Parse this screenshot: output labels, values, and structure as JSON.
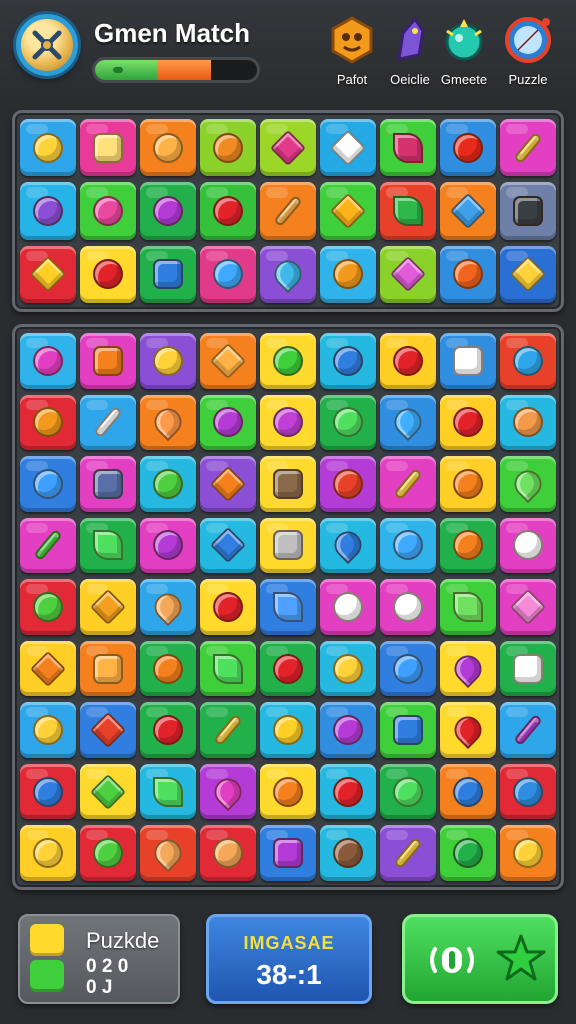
{
  "header": {
    "title": "Gmen Match",
    "progress_fraction": 0.7,
    "modes": [
      {
        "label": "Pafot",
        "icon": "orange-creature-icon",
        "color": "#f29a1c"
      },
      {
        "label": "Oeiclie",
        "icon": "purple-dragon-icon",
        "color": "#7b55d6"
      },
      {
        "label": "Gmeete",
        "icon": "teal-gem-icon",
        "color": "#25c9b0"
      },
      {
        "label": "Puzzle",
        "icon": "compass-icon",
        "color": "#2a7fd4"
      }
    ]
  },
  "top_board": {
    "rows": [
      [
        {
          "bg": "#2fa6ea",
          "fg": "#ffd33a",
          "shape": "round",
          "icon": "moon-icon"
        },
        {
          "bg": "#e93a9a",
          "fg": "#ffe07a",
          "shape": "square",
          "icon": "bell-icon"
        },
        {
          "bg": "#f4801e",
          "fg": "#ffb347",
          "shape": "round",
          "icon": "face-icon"
        },
        {
          "bg": "#8ad12a",
          "fg": "#f08a22",
          "shape": "round",
          "icon": "orange-icon"
        },
        {
          "bg": "#9bd628",
          "fg": "#e23a8a",
          "shape": "star",
          "icon": "flower-icon"
        },
        {
          "bg": "#25a9e5",
          "fg": "#ffffff",
          "shape": "star",
          "icon": "star-face-icon"
        },
        {
          "bg": "#3fcf3a",
          "fg": "#d6336e",
          "shape": "leaf",
          "icon": "berry-icon"
        },
        {
          "bg": "#2f8ee0",
          "fg": "#e82a1a",
          "shape": "round",
          "icon": "ball-icon"
        },
        {
          "bg": "#e33fc2",
          "fg": "#ffd23a",
          "shape": "bar",
          "icon": "pencil-icon"
        }
      ],
      [
        {
          "bg": "#25b3e8",
          "fg": "#8b4fd6",
          "shape": "round",
          "icon": "donut-icon"
        },
        {
          "bg": "#3fcf3a",
          "fg": "#e94aa0",
          "shape": "round",
          "icon": "lollipop-icon"
        },
        {
          "bg": "#21b04a",
          "fg": "#b43bd6",
          "shape": "round",
          "icon": "lollipop-icon"
        },
        {
          "bg": "#35c23a",
          "fg": "#e2232a",
          "shape": "round",
          "icon": "apple-icon"
        },
        {
          "bg": "#f4801e",
          "fg": "#ffb347",
          "shape": "bar",
          "icon": "carrot-icon"
        },
        {
          "bg": "#3fcf3a",
          "fg": "#ffb21a",
          "shape": "star",
          "icon": "star-icon"
        },
        {
          "bg": "#e8412a",
          "fg": "#2fb84a",
          "shape": "leaf",
          "icon": "leaf-icon"
        },
        {
          "bg": "#f4801e",
          "fg": "#3fa0ea",
          "shape": "star",
          "icon": "star-icon"
        },
        {
          "bg": "#6e7fa8",
          "fg": "#3a3f44",
          "shape": "square",
          "icon": "robot-icon"
        }
      ],
      [
        {
          "bg": "#e22a36",
          "fg": "#ffcf26",
          "shape": "star",
          "icon": "star-icon"
        },
        {
          "bg": "#ffd92b",
          "fg": "#e2232a",
          "shape": "round",
          "icon": "apple-icon"
        },
        {
          "bg": "#21b04a",
          "fg": "#2f7ee0",
          "shape": "square",
          "icon": "box-icon"
        },
        {
          "bg": "#e23a8a",
          "fg": "#3fa9ff",
          "shape": "round",
          "icon": "drop-icon"
        },
        {
          "bg": "#8b4fd6",
          "fg": "#3fb8ea",
          "shape": "drop",
          "icon": "wave-icon"
        },
        {
          "bg": "#2fb3ea",
          "fg": "#f29a1c",
          "shape": "round",
          "icon": "orange-icon"
        },
        {
          "bg": "#8ad12a",
          "fg": "#e05cd9",
          "shape": "star",
          "icon": "flower-icon"
        },
        {
          "bg": "#2f8ee0",
          "fg": "#f0641e",
          "shape": "round",
          "icon": "shell-icon"
        },
        {
          "bg": "#2a6fd4",
          "fg": "#ffd23a",
          "shape": "star",
          "icon": "sun-icon"
        }
      ]
    ]
  },
  "main_board": {
    "rows": [
      [
        {
          "bg": "#2fb3ea",
          "fg": "#e33fc2",
          "shape": "round",
          "icon": "ball-icon"
        },
        {
          "bg": "#e33fc2",
          "fg": "#f4801e",
          "shape": "square",
          "icon": "jar-icon"
        },
        {
          "bg": "#8b4fd6",
          "fg": "#ffd23a",
          "shape": "round",
          "icon": "lemon-icon"
        },
        {
          "bg": "#f4801e",
          "fg": "#ffb347",
          "shape": "star",
          "icon": "star-face-icon"
        },
        {
          "bg": "#ffd92b",
          "fg": "#3fcf3a",
          "shape": "round",
          "icon": "lollipop-icon"
        },
        {
          "bg": "#25b8e0",
          "fg": "#2f7ee0",
          "shape": "round",
          "icon": "apple-icon"
        },
        {
          "bg": "#ffcf26",
          "fg": "#e2232a",
          "shape": "round",
          "icon": "apple-icon"
        },
        {
          "bg": "#2f8ee0",
          "fg": "#ffffff",
          "shape": "square",
          "icon": "ghost-icon"
        },
        {
          "bg": "#e8412a",
          "fg": "#2fa6ea",
          "shape": "round",
          "icon": "apple-icon"
        }
      ],
      [
        {
          "bg": "#e22a36",
          "fg": "#f29a1c",
          "shape": "round",
          "icon": "apple-icon"
        },
        {
          "bg": "#2fa6ea",
          "fg": "#ffffff",
          "shape": "bar",
          "icon": "brush-icon"
        },
        {
          "bg": "#f4801e",
          "fg": "#ff9a4a",
          "shape": "drop",
          "icon": "heart-icon"
        },
        {
          "bg": "#3fcf3a",
          "fg": "#b43bd6",
          "shape": "round",
          "icon": "plum-icon"
        },
        {
          "bg": "#ffd92b",
          "fg": "#c23fd6",
          "shape": "round",
          "icon": "plum-icon"
        },
        {
          "bg": "#21b04a",
          "fg": "#4fe060",
          "shape": "round",
          "icon": "apple-icon"
        },
        {
          "bg": "#2f8ee0",
          "fg": "#3fb0ff",
          "shape": "drop",
          "icon": "drop-icon"
        },
        {
          "bg": "#ffcf26",
          "fg": "#e2232a",
          "shape": "round",
          "icon": "apple-icon"
        },
        {
          "bg": "#25b8e0",
          "fg": "#f29a4a",
          "shape": "round",
          "icon": "cat-face-icon"
        }
      ],
      [
        {
          "bg": "#2f7ee0",
          "fg": "#3fa0ff",
          "shape": "round",
          "icon": "bubble-icon"
        },
        {
          "bg": "#e33fc2",
          "fg": "#5a6fa8",
          "shape": "square",
          "icon": "tv-icon"
        },
        {
          "bg": "#25b8e0",
          "fg": "#4fd040",
          "shape": "round",
          "icon": "apple-icon"
        },
        {
          "bg": "#8b4fd6",
          "fg": "#f4801e",
          "shape": "star",
          "icon": "star-icon"
        },
        {
          "bg": "#ffd92b",
          "fg": "#8a6a4a",
          "shape": "square",
          "icon": "house-icon"
        },
        {
          "bg": "#b43bd6",
          "fg": "#e8412a",
          "shape": "round",
          "icon": "apple-icon"
        },
        {
          "bg": "#e33fc2",
          "fg": "#ffd23a",
          "shape": "bar",
          "icon": "cross-icon"
        },
        {
          "bg": "#ffcf26",
          "fg": "#f4801e",
          "shape": "round",
          "icon": "pumpkin-icon"
        },
        {
          "bg": "#3fcf3a",
          "fg": "#6fe060",
          "shape": "drop",
          "icon": "drop-icon"
        }
      ],
      [
        {
          "bg": "#e33fc2",
          "fg": "#3fcf3a",
          "shape": "bar",
          "icon": "cross-icon"
        },
        {
          "bg": "#21b04a",
          "fg": "#4fe060",
          "shape": "leaf",
          "icon": "leaf-icon"
        },
        {
          "bg": "#e33fc2",
          "fg": "#b43bd6",
          "shape": "round",
          "icon": "plum-icon"
        },
        {
          "bg": "#25b8e0",
          "fg": "#2f7ee0",
          "shape": "star",
          "icon": "gear-icon"
        },
        {
          "bg": "#ffd92b",
          "fg": "#c0c0c0",
          "shape": "square",
          "icon": "grid-icon"
        },
        {
          "bg": "#25b8e0",
          "fg": "#2f7ee0",
          "shape": "drop",
          "icon": "drop-icon"
        },
        {
          "bg": "#2fb3ea",
          "fg": "#3fa9ff",
          "shape": "round",
          "icon": "bubble-icon"
        },
        {
          "bg": "#21b04a",
          "fg": "#f4801e",
          "shape": "round",
          "icon": "orange-icon"
        },
        {
          "bg": "#e33fc2",
          "fg": "#ffffff",
          "shape": "round",
          "icon": "ghost-icon"
        }
      ],
      [
        {
          "bg": "#e22a36",
          "fg": "#4fd040",
          "shape": "round",
          "icon": "apple-icon"
        },
        {
          "bg": "#ffcf26",
          "fg": "#f4a01e",
          "shape": "star",
          "icon": "sun-icon"
        },
        {
          "bg": "#2fa6ea",
          "fg": "#f4a85a",
          "shape": "drop",
          "icon": "drop-icon"
        },
        {
          "bg": "#ffd92b",
          "fg": "#e2232a",
          "shape": "round",
          "icon": "apple-icon"
        },
        {
          "bg": "#2f7ee0",
          "fg": "#4fa0ff",
          "shape": "leaf",
          "icon": "leaf-icon"
        },
        {
          "bg": "#e33fc2",
          "fg": "#ffffff",
          "shape": "round",
          "icon": "cloud-icon"
        },
        {
          "bg": "#e33fc2",
          "fg": "#ffffff",
          "shape": "round",
          "icon": "ring-icon"
        },
        {
          "bg": "#3fcf3a",
          "fg": "#6fe060",
          "shape": "leaf",
          "icon": "leaf-icon"
        },
        {
          "bg": "#e33fc2",
          "fg": "#f58ad9",
          "shape": "star",
          "icon": "star-icon"
        }
      ],
      [
        {
          "bg": "#ffcf26",
          "fg": "#f4801e",
          "shape": "star",
          "icon": "flower-icon"
        },
        {
          "bg": "#f4801e",
          "fg": "#ffb347",
          "shape": "square",
          "icon": "house-icon"
        },
        {
          "bg": "#21b04a",
          "fg": "#f4801e",
          "shape": "round",
          "icon": "orange-icon"
        },
        {
          "bg": "#3fcf3a",
          "fg": "#4fe060",
          "shape": "leaf",
          "icon": "leaf-icon"
        },
        {
          "bg": "#21b04a",
          "fg": "#e2232a",
          "shape": "round",
          "icon": "apple-icon"
        },
        {
          "bg": "#25b8e0",
          "fg": "#ffd23a",
          "shape": "round",
          "icon": "lemon-icon"
        },
        {
          "bg": "#2f7ee0",
          "fg": "#3fa0ff",
          "shape": "round",
          "icon": "planet-icon"
        },
        {
          "bg": "#ffd92b",
          "fg": "#b43bd6",
          "shape": "drop",
          "icon": "drop-icon"
        },
        {
          "bg": "#21b04a",
          "fg": "#ffffff",
          "shape": "square",
          "icon": "cup-icon"
        }
      ],
      [
        {
          "bg": "#2fa6ea",
          "fg": "#ffd23a",
          "shape": "round",
          "icon": "lemon-icon"
        },
        {
          "bg": "#2f7ee0",
          "fg": "#e8412a",
          "shape": "star",
          "icon": "star-icon"
        },
        {
          "bg": "#21b04a",
          "fg": "#e2232a",
          "shape": "round",
          "icon": "apple-icon"
        },
        {
          "bg": "#21b04a",
          "fg": "#ffd23a",
          "shape": "bar",
          "icon": "horn-icon"
        },
        {
          "bg": "#25b8e0",
          "fg": "#ffcf26",
          "shape": "round",
          "icon": "face-icon"
        },
        {
          "bg": "#2f8ee0",
          "fg": "#b43bd6",
          "shape": "round",
          "icon": "plum-icon"
        },
        {
          "bg": "#3fcf3a",
          "fg": "#2f7ee0",
          "shape": "square",
          "icon": "jar-icon"
        },
        {
          "bg": "#ffd92b",
          "fg": "#e2232a",
          "shape": "drop",
          "icon": "heart-icon"
        },
        {
          "bg": "#2fa6ea",
          "fg": "#b43bd6",
          "shape": "bar",
          "icon": "pencil-icon"
        }
      ],
      [
        {
          "bg": "#e22a36",
          "fg": "#2f7ee0",
          "shape": "round",
          "icon": "bubble-icon"
        },
        {
          "bg": "#ffd92b",
          "fg": "#4fd040",
          "shape": "star",
          "icon": "star-icon"
        },
        {
          "bg": "#25b8e0",
          "fg": "#4fe060",
          "shape": "leaf",
          "icon": "leaf-icon"
        },
        {
          "bg": "#b43bd6",
          "fg": "#e33fc2",
          "shape": "drop",
          "icon": "heart-icon"
        },
        {
          "bg": "#ffd92b",
          "fg": "#f4801e",
          "shape": "round",
          "icon": "orange-icon"
        },
        {
          "bg": "#25b8e0",
          "fg": "#e2232a",
          "shape": "round",
          "icon": "apple-icon"
        },
        {
          "bg": "#21b04a",
          "fg": "#4fe060",
          "shape": "round",
          "icon": "apple-icon"
        },
        {
          "bg": "#f4801e",
          "fg": "#2f7ee0",
          "shape": "round",
          "icon": "eye-icon"
        },
        {
          "bg": "#e22a36",
          "fg": "#2f8ee0",
          "shape": "round",
          "icon": "bubble-icon"
        }
      ],
      [
        {
          "bg": "#ffcf26",
          "fg": "#ffd23a",
          "shape": "round",
          "icon": "face-icon"
        },
        {
          "bg": "#e22a36",
          "fg": "#4fd040",
          "shape": "round",
          "icon": "apple-icon"
        },
        {
          "bg": "#e8412a",
          "fg": "#f4a85a",
          "shape": "drop",
          "icon": "drumstick-icon"
        },
        {
          "bg": "#e22a36",
          "fg": "#f4a85a",
          "shape": "round",
          "icon": "mushroom-icon"
        },
        {
          "bg": "#2f7ee0",
          "fg": "#b43bd6",
          "shape": "square",
          "icon": "tv-icon"
        },
        {
          "bg": "#25b8e0",
          "fg": "#8a5a3a",
          "shape": "round",
          "icon": "person-icon"
        },
        {
          "bg": "#8b4fd6",
          "fg": "#ffd23a",
          "shape": "bar",
          "icon": "wand-icon"
        },
        {
          "bg": "#3fcf3a",
          "fg": "#21b04a",
          "shape": "round",
          "icon": "apple-icon"
        },
        {
          "bg": "#f4801e",
          "fg": "#ffd23a",
          "shape": "round",
          "icon": "face-icon"
        }
      ]
    ]
  },
  "footer": {
    "puzzle_panel": {
      "title": "Puzkde",
      "line1": "0 2 0",
      "line2": "0 J"
    },
    "score_panel": {
      "label": "IMGASAE",
      "value": "38-:1"
    },
    "action_panel": {
      "icons": [
        "sound-icon",
        "star-icon"
      ]
    }
  }
}
